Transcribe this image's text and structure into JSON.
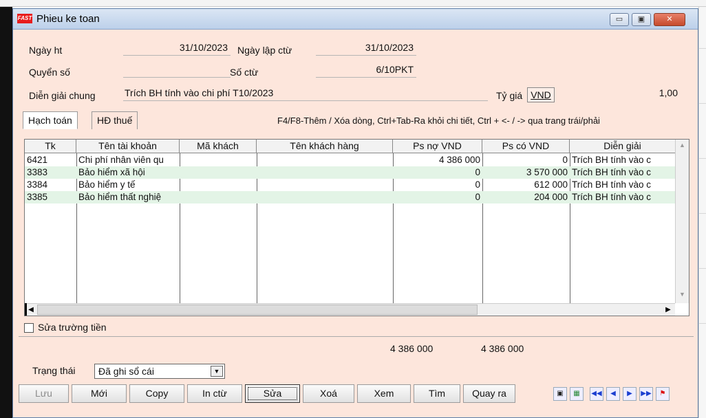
{
  "window": {
    "title": "Phieu ke toan",
    "logo": "FAST",
    "controls": {
      "minimize": "▭",
      "restore": "▣",
      "close": "✕"
    }
  },
  "header": {
    "ngay_ht_label": "Ngày ht",
    "ngay_ht_value": "31/10/2023",
    "ngay_lap_ctu_label": "Ngày lập ctừ",
    "ngay_lap_ctu_value": "31/10/2023",
    "quyen_so_label": "Quyển số",
    "quyen_so_value": "",
    "so_ctu_label": "Số ctừ",
    "so_ctu_value": "6/10PKT",
    "dien_giai_label": "Diễn giải chung",
    "dien_giai_value": "Trích BH tính vào chi phí T10/2023",
    "ty_gia_label": "Tỷ giá",
    "currency": "VND",
    "ty_gia_value": "1,00"
  },
  "tabs": [
    {
      "label": "Hạch toán"
    },
    {
      "label": "HĐ thuế"
    }
  ],
  "hint": "F4/F8-Thêm / Xóa dòng, Ctrl+Tab-Ra khỏi chi tiết, Ctrl + <- / -> qua trang trái/phải",
  "table": {
    "columns": [
      "Tk",
      "Tên tài khoản",
      "Mã khách",
      "Tên khách hàng",
      "Ps nợ VND",
      "Ps có VND",
      "Diễn giải"
    ],
    "rows": [
      {
        "tk": "6421",
        "ten_tk": "Chi phí nhân viên qu",
        "ma_khach": "",
        "ten_kh": "",
        "ps_no": "4 386 000",
        "ps_co": "0",
        "dien_giai": "Trích BH tính vào c"
      },
      {
        "tk": "3383",
        "ten_tk": "Bảo hiểm xã hội",
        "ma_khach": "",
        "ten_kh": "",
        "ps_no": "0",
        "ps_co": "3 570 000",
        "dien_giai": "Trích BH tính vào c"
      },
      {
        "tk": "3384",
        "ten_tk": "Bảo hiểm y tế",
        "ma_khach": "",
        "ten_kh": "",
        "ps_no": "0",
        "ps_co": "612 000",
        "dien_giai": "Trích BH tính vào c"
      },
      {
        "tk": "3385",
        "ten_tk": "Bảo hiểm thất nghiệ",
        "ma_khach": "",
        "ten_kh": "",
        "ps_no": "0",
        "ps_co": "204 000",
        "dien_giai": "Trích BH tính vào c"
      }
    ]
  },
  "checkbox_label": "Sửa trường tiền",
  "totals": {
    "no": "4 386 000",
    "co": "4 386 000"
  },
  "status": {
    "label": "Trạng thái",
    "value": "Đã ghi sổ cái"
  },
  "buttons": {
    "luu": "Lưu",
    "moi": "Mới",
    "copy": "Copy",
    "in_ctu": "In ctừ",
    "sua": "Sửa",
    "xoa": "Xoá",
    "xem": "Xem",
    "tim": "Tìm",
    "quay_ra": "Quay ra"
  },
  "nav_icons": [
    "save-disk-icon",
    "calculator-icon",
    "first-record-icon",
    "previous-record-icon",
    "next-record-icon",
    "last-record-icon",
    "flag-icon"
  ],
  "colors": {
    "window_bg": "#fde6dc",
    "alt_row": "#e3f4e6",
    "title_bar": "#bcd0ea"
  }
}
